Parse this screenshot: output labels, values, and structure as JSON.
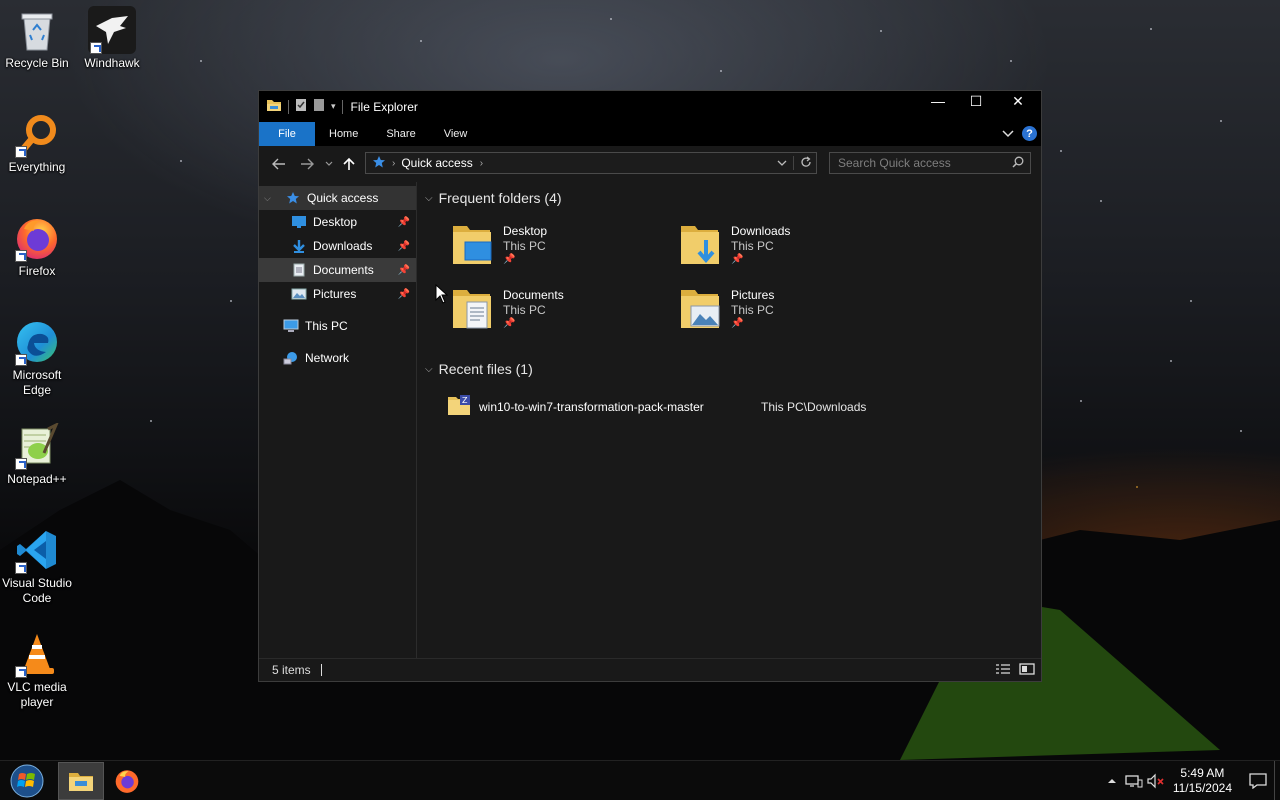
{
  "desktop": {
    "icons": [
      {
        "label": "Recycle Bin",
        "icon": "recycle-bin-icon"
      },
      {
        "label": "Windhawk",
        "icon": "windhawk-icon"
      },
      {
        "label": "Everything",
        "icon": "everything-search-icon"
      },
      {
        "label": "Firefox",
        "icon": "firefox-icon"
      },
      {
        "label": "Microsoft Edge",
        "icon": "edge-icon"
      },
      {
        "label": "Notepad++",
        "icon": "notepadpp-icon"
      },
      {
        "label": "Visual Studio Code",
        "icon": "vscode-icon"
      },
      {
        "label": "VLC media player",
        "icon": "vlc-icon"
      }
    ]
  },
  "explorer": {
    "title": "File Explorer",
    "window_controls": {
      "minimize": "—",
      "maximize": "☐",
      "close": "✕"
    },
    "ribbon_tabs": [
      "File",
      "Home",
      "Share",
      "View"
    ],
    "help": "?",
    "address": {
      "crumb": "Quick access"
    },
    "search": {
      "placeholder": "Search Quick access"
    },
    "nav": {
      "quick_access": "Quick access",
      "items": [
        {
          "label": "Desktop",
          "icon": "desktop-folder-icon",
          "pinned": true
        },
        {
          "label": "Downloads",
          "icon": "downloads-folder-icon",
          "pinned": true
        },
        {
          "label": "Documents",
          "icon": "documents-folder-icon",
          "pinned": true
        },
        {
          "label": "Pictures",
          "icon": "pictures-folder-icon",
          "pinned": true
        }
      ],
      "this_pc": "This PC",
      "network": "Network"
    },
    "frequent": {
      "heading": "Frequent folders (4)",
      "folders": [
        {
          "name": "Desktop",
          "location": "This PC"
        },
        {
          "name": "Downloads",
          "location": "This PC"
        },
        {
          "name": "Documents",
          "location": "This PC"
        },
        {
          "name": "Pictures",
          "location": "This PC"
        }
      ]
    },
    "recent": {
      "heading": "Recent files (1)",
      "files": [
        {
          "name": "win10-to-win7-transformation-pack-master",
          "path": "This PC\\Downloads"
        }
      ]
    },
    "status": {
      "items": "5 items"
    }
  },
  "taskbar": {
    "clock": {
      "time": "5:49 AM",
      "date": "11/15/2024"
    },
    "tray_icons": [
      "chevron-up-icon",
      "network-icon",
      "volume-muted-icon",
      "notification-icon"
    ]
  },
  "colors": {
    "accent": "#1a73c8",
    "window_bg": "#191919",
    "titlebar": "#000000"
  }
}
